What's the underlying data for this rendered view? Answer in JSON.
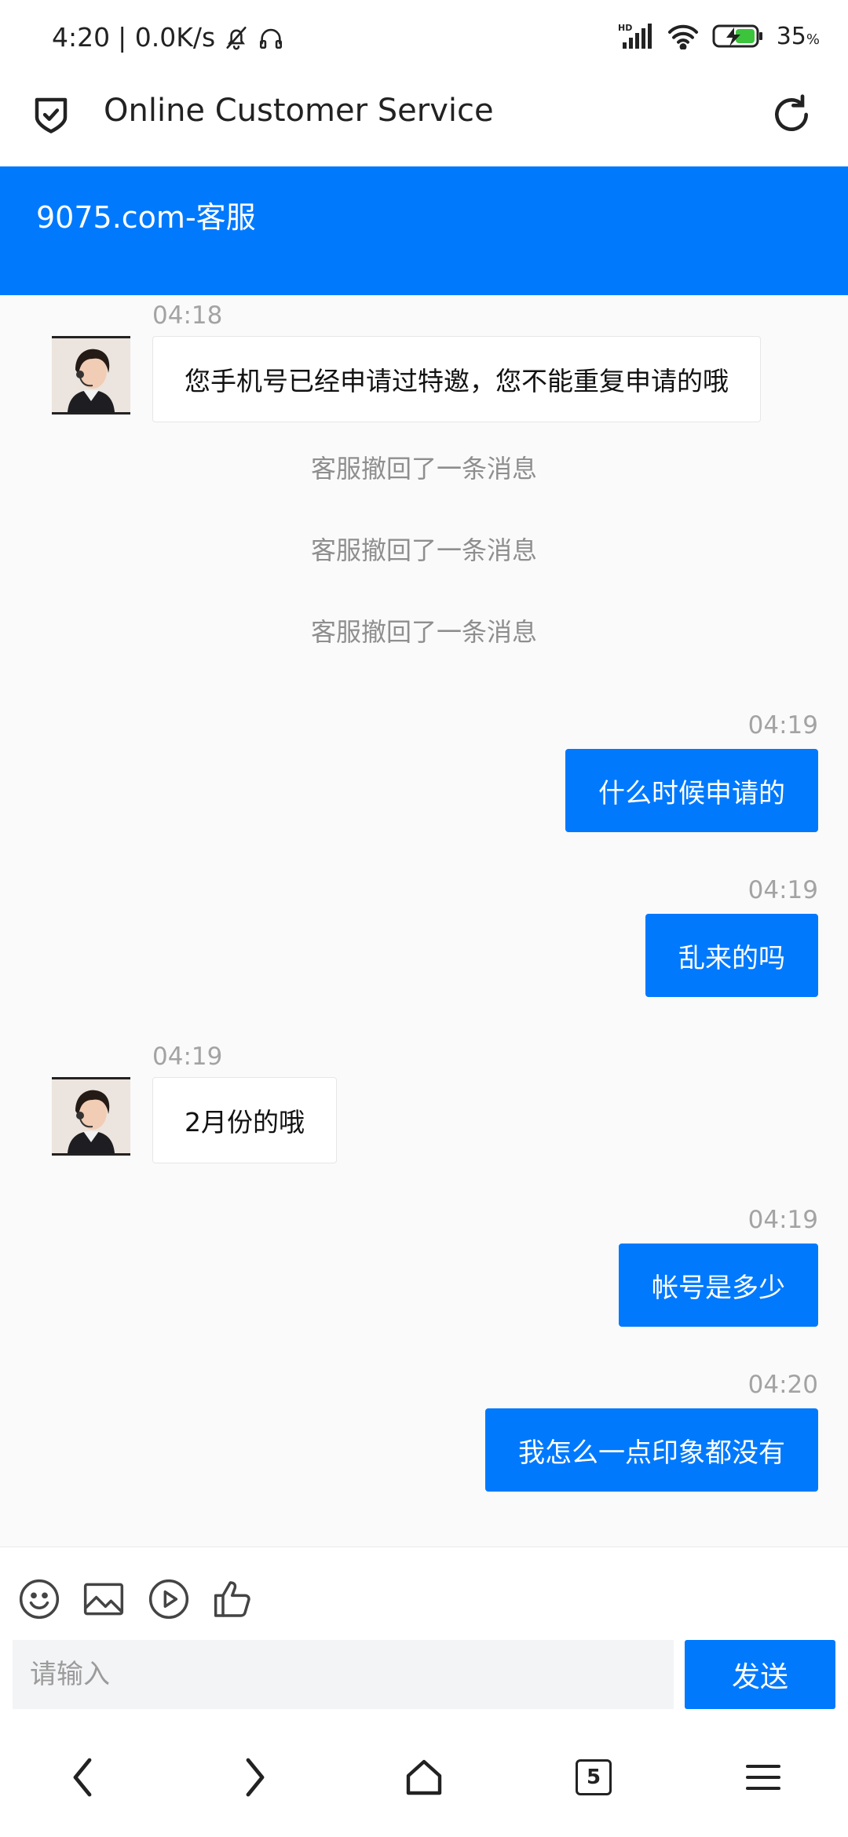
{
  "status_bar": {
    "time": "4:20",
    "speed": "| 0.0K/s",
    "battery": "35",
    "battery_unit": "%",
    "icons": [
      "bell-off-icon",
      "headphones-icon",
      "hd-signal-icon",
      "wifi-icon",
      "battery-charging-icon"
    ]
  },
  "header": {
    "title": "Online Customer Service",
    "left_icon": "shield-check-icon",
    "right_icon": "refresh-icon"
  },
  "banner": {
    "title": "9075.com-客服"
  },
  "messages": [
    {
      "side": "in",
      "time": "04:18",
      "text": "您手机号已经申请过特邀，您不能重复申请的哦"
    },
    {
      "side": "system",
      "text": "客服撤回了一条消息"
    },
    {
      "side": "system",
      "text": "客服撤回了一条消息"
    },
    {
      "side": "system",
      "text": "客服撤回了一条消息"
    },
    {
      "side": "out",
      "time": "04:19",
      "text": "什么时候申请的"
    },
    {
      "side": "out",
      "time": "04:19",
      "text": "乱来的吗"
    },
    {
      "side": "in",
      "time": "04:19",
      "text": "2月份的哦"
    },
    {
      "side": "out",
      "time": "04:19",
      "text": "帐号是多少"
    },
    {
      "side": "out",
      "time": "04:20",
      "text": "我怎么一点印象都没有"
    }
  ],
  "toolbar": {
    "icons": [
      "emoji-icon",
      "image-icon",
      "video-icon",
      "thumbs-up-icon"
    ]
  },
  "composer": {
    "placeholder": "请输入",
    "value": "",
    "send_label": "发送"
  },
  "nav": {
    "tabs_count": "5",
    "icons": [
      "back-icon",
      "forward-icon",
      "home-icon",
      "tabs-icon",
      "menu-icon"
    ]
  },
  "colors": {
    "accent": "#0079fd",
    "background": "#fafafa"
  }
}
